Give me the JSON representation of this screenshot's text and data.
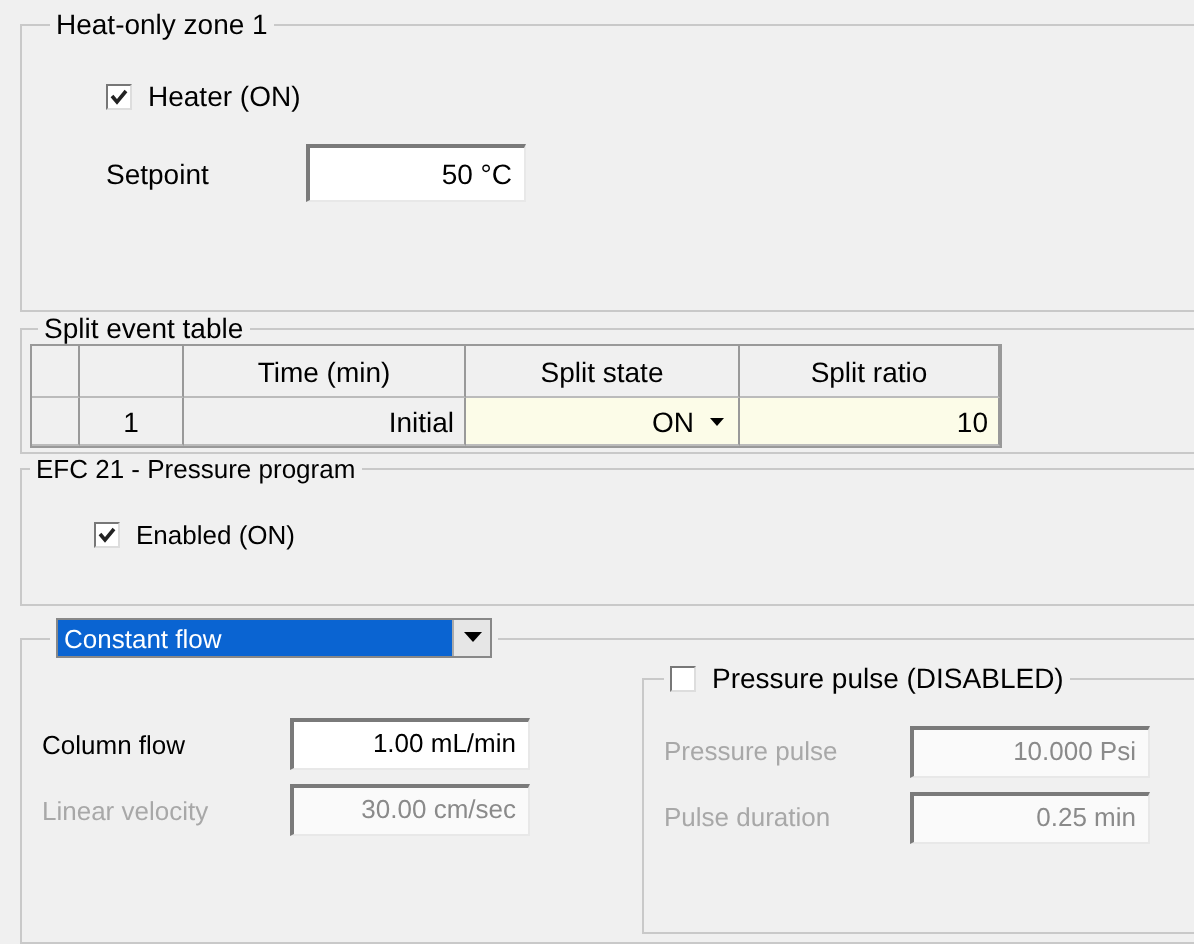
{
  "heat_zone": {
    "title": "Heat-only zone 1",
    "heater": {
      "label": "Heater (ON)",
      "checked": true
    },
    "setpoint": {
      "label": "Setpoint",
      "value": "50 °C"
    }
  },
  "split_table": {
    "title": "Split event table",
    "columns": [
      "Time (min)",
      "Split state",
      "Split ratio"
    ],
    "rows": [
      {
        "index": "1",
        "time": "Initial",
        "state": "ON",
        "ratio": "10"
      }
    ]
  },
  "pressure_program": {
    "title": "EFC 21 - Pressure program",
    "enabled": {
      "label": "Enabled (ON)",
      "checked": true
    }
  },
  "flow": {
    "mode": "Constant flow",
    "fields": [
      {
        "label": "Column flow",
        "value": "1.00 mL/min",
        "disabled": false
      },
      {
        "label": "Linear velocity",
        "value": "30.00 cm/sec",
        "disabled": true
      }
    ],
    "pulse": {
      "label": "Pressure pulse (DISABLED)",
      "checked": false,
      "fields": [
        {
          "label": "Pressure pulse",
          "value": "10.000 Psi",
          "disabled": true
        },
        {
          "label": "Pulse duration",
          "value": "0.25 min",
          "disabled": true
        }
      ]
    }
  }
}
